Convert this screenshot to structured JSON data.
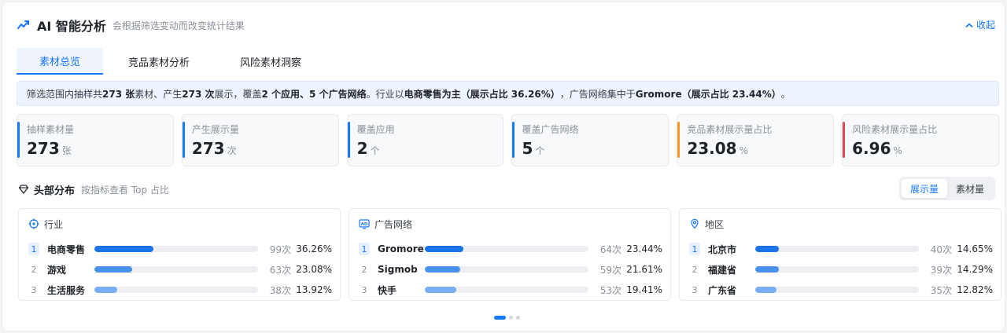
{
  "header": {
    "title": "AI 智能分析",
    "subtitle": "会根据筛选变动而改变统计结果",
    "collapse_label": "收起"
  },
  "tabs": [
    {
      "label": "素材总览",
      "active": true
    },
    {
      "label": "竞品素材分析",
      "active": false
    },
    {
      "label": "风险素材洞察",
      "active": false
    }
  ],
  "summary": {
    "p1": "筛选范围内抽样共 ",
    "b1": "273 张",
    "p2": "素材、产生 ",
    "b2": "273 次",
    "p3": "展示，覆盖 ",
    "b3": "2 个应用、5 个广告网络",
    "p4": "。行业以",
    "b4": "电商零售为主（展示占比 36.26%）",
    "p5": "，广告网络集中于",
    "b5": "Gromore（展示占比 23.44%）",
    "p6": "。"
  },
  "metrics": [
    {
      "label": "抽样素材量",
      "value": "273",
      "unit": "张",
      "color": "#1677ff"
    },
    {
      "label": "产生展示量",
      "value": "273",
      "unit": "次",
      "color": "#1677ff"
    },
    {
      "label": "覆盖应用",
      "value": "2",
      "unit": "个",
      "color": "#1677ff"
    },
    {
      "label": "覆盖广告网络",
      "value": "5",
      "unit": "个",
      "color": "#1677ff"
    },
    {
      "label": "竞品素材展示量占比",
      "value": "23.08",
      "unit": "%",
      "color": "#f59a23"
    },
    {
      "label": "风险素材展示量占比",
      "value": "6.96",
      "unit": "%",
      "color": "#e5484d"
    }
  ],
  "distribution": {
    "title": "头部分布",
    "subtitle": "按指标查看 Top 占比",
    "toggle": [
      {
        "label": "展示量",
        "active": true
      },
      {
        "label": "素材量",
        "active": false
      }
    ],
    "cards": [
      {
        "title": "行业",
        "icon": "target-icon",
        "rows": [
          {
            "rank": "1",
            "name": "电商零售",
            "count": "99次",
            "pct": "36.26%",
            "share": 36.26
          },
          {
            "rank": "2",
            "name": "游戏",
            "count": "63次",
            "pct": "23.08%",
            "share": 23.08
          },
          {
            "rank": "3",
            "name": "生活服务",
            "count": "38次",
            "pct": "13.92%",
            "share": 13.92
          }
        ]
      },
      {
        "title": "广告网络",
        "icon": "ad-icon",
        "rows": [
          {
            "rank": "1",
            "name": "Gromore",
            "count": "64次",
            "pct": "23.44%",
            "share": 23.44
          },
          {
            "rank": "2",
            "name": "Sigmob",
            "count": "59次",
            "pct": "21.61%",
            "share": 21.61
          },
          {
            "rank": "3",
            "name": "快手",
            "count": "53次",
            "pct": "19.41%",
            "share": 19.41
          }
        ]
      },
      {
        "title": "地区",
        "icon": "location-icon",
        "rows": [
          {
            "rank": "1",
            "name": "北京市",
            "count": "40次",
            "pct": "14.65%",
            "share": 14.65
          },
          {
            "rank": "2",
            "name": "福建省",
            "count": "39次",
            "pct": "14.29%",
            "share": 14.29
          },
          {
            "rank": "3",
            "name": "广东省",
            "count": "35次",
            "pct": "12.82%",
            "share": 12.82
          }
        ]
      }
    ]
  },
  "colors": {
    "accent": "#1677ff",
    "bar_rank1": "#1a73e8",
    "bar_rank2": "#4a90ee",
    "bar_rank3": "#7aaef4"
  }
}
